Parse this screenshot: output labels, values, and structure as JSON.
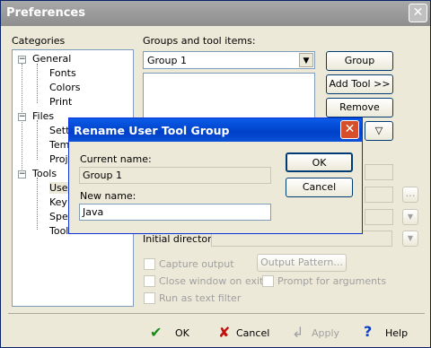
{
  "window": {
    "title": "Preferences",
    "close_glyph": "✕"
  },
  "categories": {
    "label": "Categories",
    "items": [
      {
        "label": "General",
        "expander": "−"
      },
      {
        "label": "Fonts"
      },
      {
        "label": "Colors"
      },
      {
        "label": "Print"
      },
      {
        "label": "Files",
        "expander": "−"
      },
      {
        "label": "Setti"
      },
      {
        "label": "Tem"
      },
      {
        "label": "Proj"
      },
      {
        "label": "Tools",
        "expander": "−"
      },
      {
        "label": "User"
      },
      {
        "label": "Key"
      },
      {
        "label": "Spe"
      },
      {
        "label": "Toolbar"
      }
    ]
  },
  "groups": {
    "label": "Groups and tool items:",
    "selected": "Group 1",
    "dropdown_glyph": "▼"
  },
  "side_buttons": {
    "group_name": "Group Name...",
    "add_tool": "Add Tool >>",
    "remove": "Remove",
    "down_glyph": "▽"
  },
  "initial_directory": {
    "label": "Initial directory:"
  },
  "options": {
    "capture_output": "Capture output",
    "close_window": "Close window on exit",
    "run_as_filter": "Run as text filter",
    "output_pattern": "Output Pattern...",
    "prompt_args": "Prompt for arguments"
  },
  "dialog": {
    "title": "Rename User Tool Group",
    "close_glyph": "✕",
    "current_label": "Current name:",
    "current_value": "Group 1",
    "new_label": "New name:",
    "new_value": "Java",
    "ok": "OK",
    "cancel": "Cancel"
  },
  "footer": {
    "ok": "OK",
    "ok_icon": "✔",
    "cancel": "Cancel",
    "cancel_icon": "✘",
    "apply": "Apply",
    "apply_icon": "↲",
    "help": "Help",
    "help_icon": "?"
  },
  "colors": {
    "ok": "#1a8a1a",
    "cancel": "#c01010",
    "help": "#1040c0",
    "accent": "#0a52d8"
  }
}
